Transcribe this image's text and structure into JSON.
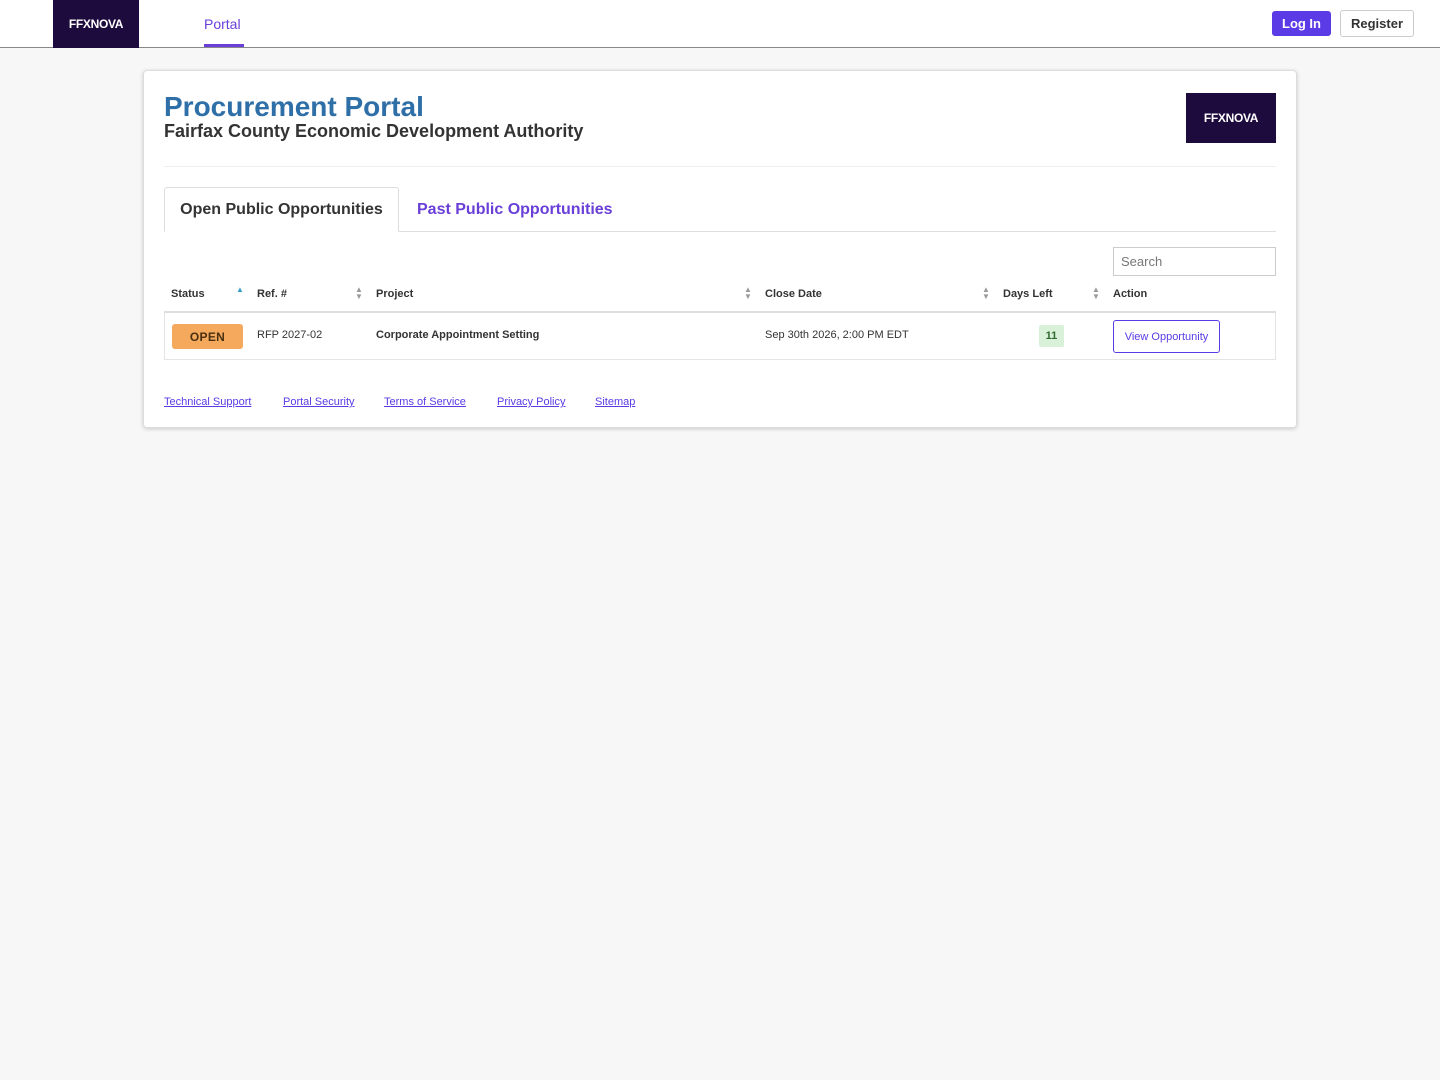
{
  "nav": {
    "logo_text": "FFXNOVA",
    "portal_link": "Portal",
    "login": "Log In",
    "register": "Register"
  },
  "header": {
    "title": "Procurement Portal",
    "subtitle": "Fairfax County Economic Development Authority",
    "logo_text": "FFXNOVA"
  },
  "tabs": [
    {
      "label": "Open Public Opportunities",
      "active": true
    },
    {
      "label": "Past Public Opportunities",
      "active": false
    }
  ],
  "search": {
    "placeholder": "Search"
  },
  "table": {
    "columns": [
      "Status",
      "Ref. #",
      "Project",
      "Close Date",
      "Days Left",
      "Action"
    ],
    "rows": [
      {
        "status": "OPEN",
        "ref": "RFP 2027-02",
        "project": "Corporate Appointment Setting",
        "close_date": "Sep 30th 2026, 2:00 PM EDT",
        "days_left": "11",
        "action": "View Opportunity"
      }
    ]
  },
  "footer": {
    "links": [
      "Technical Support",
      "Portal Security",
      "Terms of Service",
      "Privacy Policy",
      "Sitemap"
    ]
  },
  "colors": {
    "brand_dark": "#1e0b3d",
    "accent_purple": "#5b3be6",
    "title_blue": "#2f6fa8",
    "status_open": "#f4a95d",
    "days_left_bg": "#d9f0d9"
  }
}
